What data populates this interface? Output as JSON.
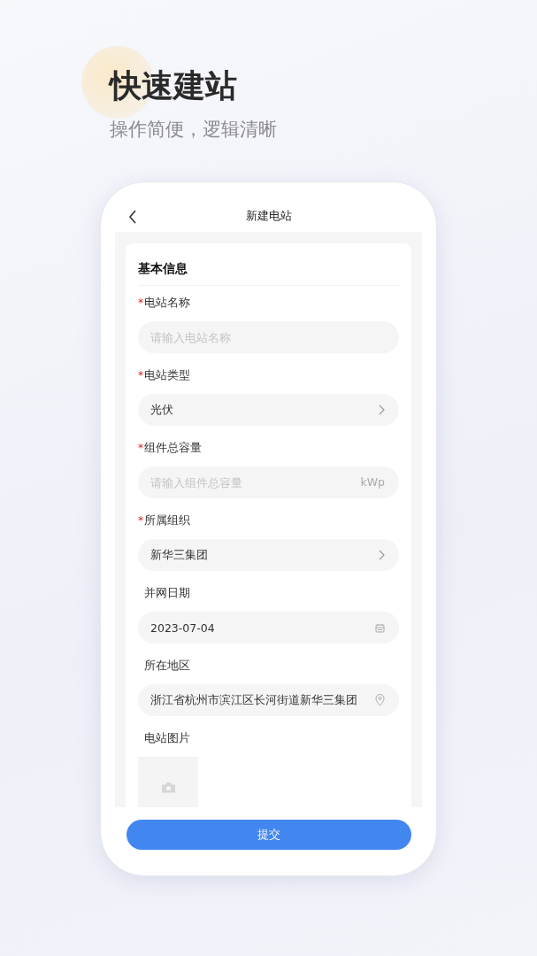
{
  "headline": {
    "title": "快速建站",
    "subtitle": "操作简便，逻辑清晰"
  },
  "app": {
    "nav_title": "新建电站",
    "section_title": "基本信息",
    "fields": [
      {
        "kind": "input",
        "required_mark": "*",
        "label": "电站名称",
        "placeholder": "请输入电站名称"
      },
      {
        "kind": "select",
        "required_mark": "*",
        "label": "电站类型",
        "value": "光伏"
      },
      {
        "kind": "input",
        "required_mark": "*",
        "label": "组件总容量",
        "placeholder": "请输入组件总容量",
        "unit": "kWp"
      },
      {
        "kind": "select",
        "required_mark": "*",
        "label": "所属组织",
        "value": "新华三集团"
      },
      {
        "kind": "date",
        "label": "并网日期",
        "value": "2023-07-04"
      },
      {
        "kind": "location",
        "label": "所在地区",
        "value": "浙江省杭州市滨江区长河街道新华三集团"
      },
      {
        "kind": "photo",
        "label": "电站图片"
      }
    ],
    "submit": "提交"
  }
}
